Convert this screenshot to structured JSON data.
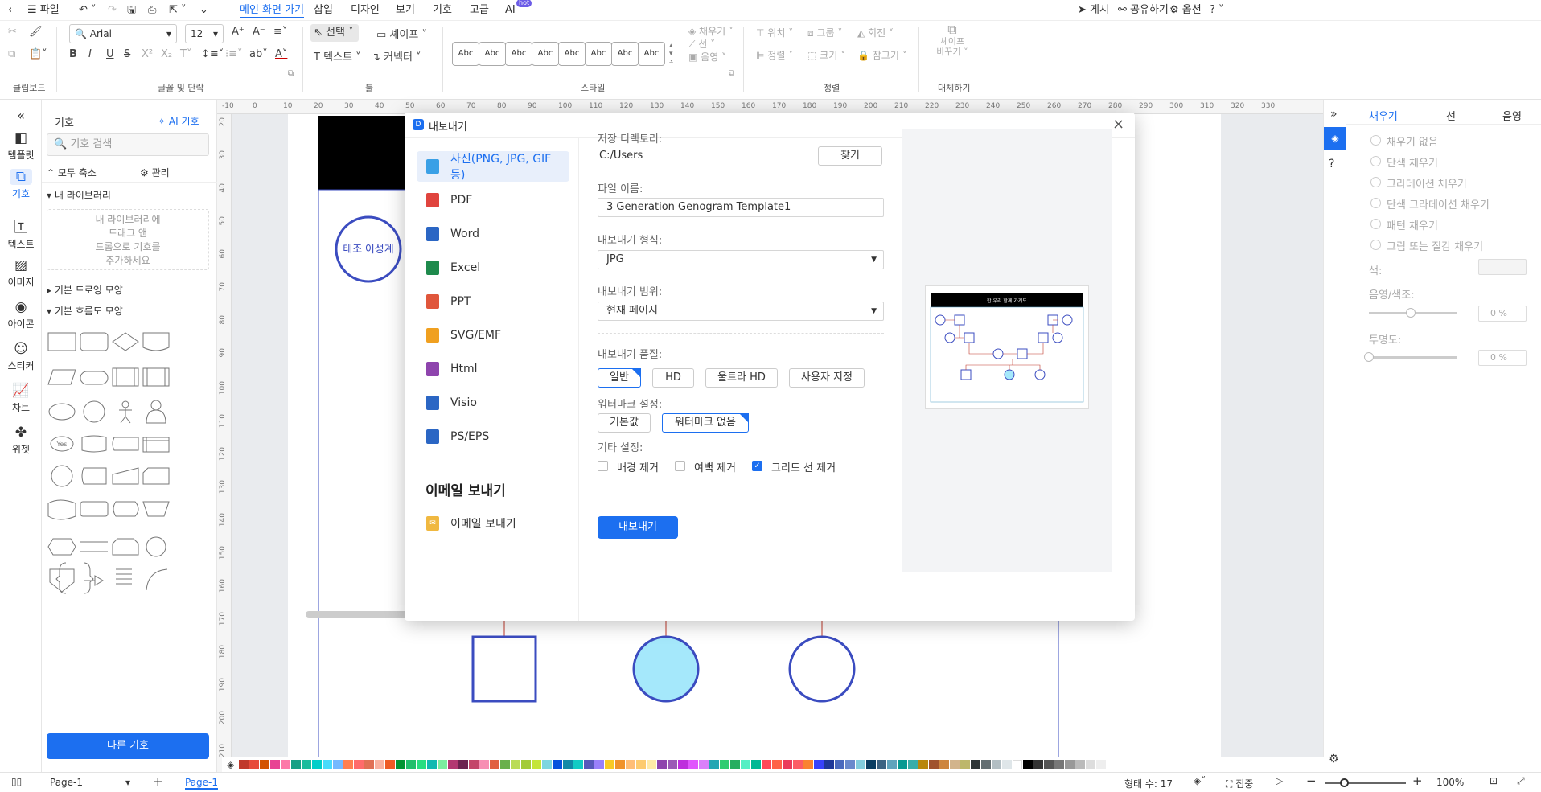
{
  "menubar": {
    "file": "파일",
    "tabs": [
      "메인 화면 가기",
      "삽입",
      "디자인",
      "보기",
      "기호",
      "고급",
      "AI"
    ],
    "hot_badge": "hot",
    "right": {
      "publish": "게시",
      "share": "공유하기",
      "options": "옵션",
      "help": "?"
    }
  },
  "ribbon": {
    "groups": {
      "clipboard": "클립보드",
      "font": "글꼴 및 단락",
      "tools": "툴",
      "style": "스타일",
      "arrange": "정렬",
      "replace": "대체하기"
    },
    "font_name": "Arial",
    "font_size": "12",
    "select": "선택",
    "shape": "셰이프",
    "text": "텍스트",
    "connector": "커넥터",
    "style_samples": [
      "Abc",
      "Abc",
      "Abc",
      "Abc",
      "Abc",
      "Abc",
      "Abc",
      "Abc"
    ],
    "fill": "채우기",
    "line": "선",
    "shadow": "음영",
    "position": "위치",
    "group": "그룹",
    "rotate": "회전",
    "align": "정렬",
    "size": "크기",
    "lock": "잠그기",
    "replace_shape": "셰이프\n바꾸기"
  },
  "leftnav": {
    "collapse": "«",
    "items": [
      "템플릿",
      "기호",
      "텍스트",
      "이미지",
      "아이콘",
      "스티커",
      "차트",
      "위젯"
    ]
  },
  "symbols": {
    "title": "기호",
    "ai": "AI 기호",
    "search_placeholder": "기호 검색",
    "collapse_all": "모두 축소",
    "manage": "관리",
    "my_library": "내 라이브러리",
    "my_library_hint": "내 라이브러리에\n드래그 앤\n드롭으로 기호를\n추가하세요",
    "basic_drawing": "기본 드로잉 모양",
    "basic_flow": "기본 흐름도 모양",
    "more_button": "다른 기호",
    "yes_label": "Yes"
  },
  "canvas": {
    "left_node_label": "태조 이성계"
  },
  "dialog": {
    "title": "내보내기",
    "formats": [
      "사진(PNG, JPG, GIF 등)",
      "PDF",
      "Word",
      "Excel",
      "PPT",
      "SVG/EMF",
      "Html",
      "Visio",
      "PS/EPS"
    ],
    "format_colors": [
      "#3aa0e6",
      "#e0443e",
      "#2b66c4",
      "#1e8a4c",
      "#e0563b",
      "#f0a020",
      "#8e44ad",
      "#2b66c4",
      "#2b66c4"
    ],
    "email_header": "이메일 보내기",
    "email_item": "이메일 보내기",
    "save_dir_label": "저장 디렉토리:",
    "save_dir_value": "C:/Users",
    "browse": "찾기",
    "filename_label": "파일 이름:",
    "filename_value": "3 Generation Genogram Template1",
    "format_label": "내보내기 형식:",
    "format_value": "JPG",
    "range_label": "내보내기 범위:",
    "range_value": "현재 페이지",
    "quality_label": "내보내기 품질:",
    "quality_options": [
      "일반",
      "HD",
      "울트라 HD",
      "사용자 지정"
    ],
    "watermark_label": "워터마크 설정:",
    "watermark_options": [
      "기본값",
      "워터마크 없음"
    ],
    "other_label": "기타 설정:",
    "other_options": [
      "배경 제거",
      "여백 제거",
      "그리드 선 제거"
    ],
    "export_button": "내보내기",
    "preview_title": "한 우리 함께 가계도"
  },
  "rightpanel": {
    "tabs": [
      "채우기",
      "선",
      "음영"
    ],
    "fill_options": [
      "채우기 없음",
      "단색 채우기",
      "그라데이션 채우기",
      "단색 그라데이션 채우기",
      "패턴 채우기",
      "그림 또는 질감 채우기"
    ],
    "color_label": "색:",
    "shade_label": "음영/색조:",
    "shade_value": "0 %",
    "transparency_label": "투명도:",
    "transparency_value": "0 %"
  },
  "statusbar": {
    "page_select": "Page-1",
    "page_tab": "Page-1",
    "shape_count": "형태 수: 17",
    "focus": "집중",
    "zoom": "100%"
  },
  "ruler_top": [
    "20",
    "-10",
    "0",
    "10",
    "20",
    "30",
    "40",
    "50",
    "60",
    "70",
    "80",
    "90",
    "100",
    "110",
    "120",
    "130",
    "140",
    "150",
    "160",
    "170",
    "180",
    "190",
    "200",
    "210",
    "220",
    "230",
    "240",
    "250",
    "260",
    "270",
    "280",
    "290",
    "300",
    "310",
    "320",
    "330"
  ],
  "ruler_left": [
    "20",
    "30",
    "40",
    "50",
    "60",
    "70",
    "80",
    "90",
    "100",
    "110",
    "120",
    "130",
    "140",
    "150",
    "160",
    "170",
    "180",
    "190",
    "200",
    "210"
  ],
  "palette": [
    "#c0392b",
    "#e74c3c",
    "#d35400",
    "#e84393",
    "#fd79a8",
    "#16a085",
    "#1abc9c",
    "#00cec9",
    "#48dbfb",
    "#74b9ff",
    "#ff7f50",
    "#ff6b6b",
    "#e17055",
    "#fab1a0",
    "#ee5a24",
    "#009432",
    "#20bf6b",
    "#26de81",
    "#0fb9b1",
    "#7bed9f",
    "#b33771",
    "#6d214f",
    "#c44569",
    "#f78fb3",
    "#e15f41",
    "#6ab04c",
    "#badc58",
    "#a3cb38",
    "#c4e538",
    "#7ed6df",
    "#0652dd",
    "#1289a7",
    "#12cbc4",
    "#5758bb",
    "#9980fa",
    "#f9ca24",
    "#f0932b",
    "#ffbe76",
    "#fdcb6e",
    "#ffeaa7",
    "#8e44ad",
    "#9b59b6",
    "#be2edd",
    "#e056fd",
    "#d980fa",
    "#22a6b3",
    "#2ecc71",
    "#27ae60",
    "#55efc4",
    "#00b894",
    "#ff4757",
    "#ff6348",
    "#eb3b5a",
    "#fc5c65",
    "#fa8231",
    "#3742fa",
    "#1e3799",
    "#4a69bd",
    "#6a89cc",
    "#82ccdd",
    "#0a3d62",
    "#3c6382",
    "#60a3bc",
    "#079992",
    "#38ada9",
    "#b8860b",
    "#a0522d",
    "#cd853f",
    "#d2b48c",
    "#bdb76b",
    "#2d3436",
    "#636e72",
    "#b2bec3",
    "#dfe6e9",
    "#ffffff",
    "#000000",
    "#333333",
    "#555555",
    "#777777",
    "#999999",
    "#bbbbbb",
    "#dddddd",
    "#eeeeee"
  ],
  "colors": {
    "accent": "#1c6ff0",
    "node_stroke": "#3b4cc0",
    "node_fill_light": "#a5e8fb",
    "edge": "#c0392b"
  }
}
